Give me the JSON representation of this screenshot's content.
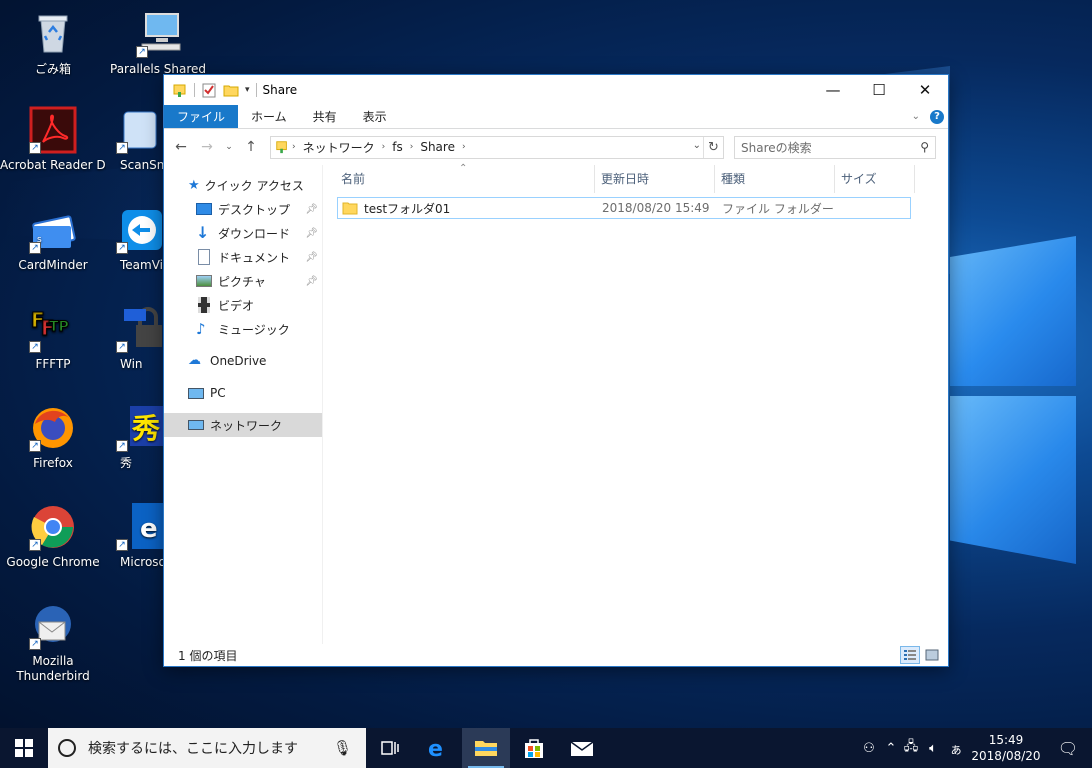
{
  "desktop": {
    "icons_col1": [
      {
        "label": "ごみ箱",
        "icon": "recycle-bin-icon"
      },
      {
        "label": "Acrobat Reader DC",
        "icon": "acrobat-icon"
      },
      {
        "label": "CardMinder",
        "icon": "cardminder-icon"
      },
      {
        "label": "FFFTP",
        "icon": "ffftp-icon"
      },
      {
        "label": "Firefox",
        "icon": "firefox-icon"
      },
      {
        "label": "Google Chrome",
        "icon": "chrome-icon"
      },
      {
        "label": "Mozilla\nThunderbird",
        "icon": "thunderbird-icon"
      }
    ],
    "icons_col2": [
      {
        "label": "Parallels Shared Fold",
        "icon": "parallels-icon"
      },
      {
        "label": "ScanSnap",
        "icon": "scansnap-icon"
      },
      {
        "label": "TeamVie",
        "icon": "teamviewer-icon"
      },
      {
        "label": "Win",
        "icon": "winscp-icon"
      },
      {
        "label": "秀",
        "icon": "hidemaru-icon"
      },
      {
        "label": "Microso",
        "icon": "edge-icon"
      }
    ]
  },
  "explorer": {
    "title": "Share",
    "controls": {
      "minimize": "—",
      "maximize": "☐",
      "close": "✕"
    },
    "ribbon_tabs": [
      "ファイル",
      "ホーム",
      "共有",
      "表示"
    ],
    "breadcrumb": [
      "ネットワーク",
      "fs",
      "Share"
    ],
    "search_placeholder": "Shareの検索",
    "nav": {
      "quick_access": "クイック アクセス",
      "quick_items": [
        "デスクトップ",
        "ダウンロード",
        "ドキュメント",
        "ピクチャ",
        "ビデオ",
        "ミュージック"
      ],
      "onedrive": "OneDrive",
      "pc": "PC",
      "network": "ネットワーク"
    },
    "columns": [
      "名前",
      "更新日時",
      "種類",
      "サイズ"
    ],
    "files": [
      {
        "name": "testフォルダ01",
        "modified": "2018/08/20 15:49",
        "type": "ファイル フォルダー",
        "size": ""
      }
    ],
    "status": "1 個の項目"
  },
  "taskbar": {
    "search_placeholder": "検索するには、ここに入力します",
    "time": "15:49",
    "date": "2018/08/20",
    "ime": "ぁ"
  },
  "colors": {
    "accent": "#1979ca",
    "taskbar": "#0a1630",
    "selection_border": "#99d1ff"
  }
}
